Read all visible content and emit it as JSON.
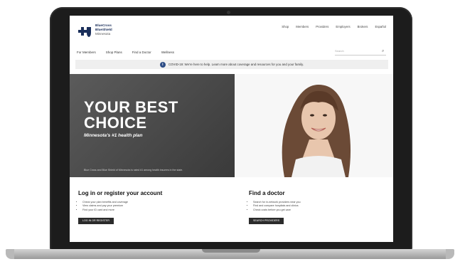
{
  "brand": {
    "line1": "BlueCross",
    "line2": "BlueShield",
    "line3": "Minnesota"
  },
  "utility_nav": [
    "Shop",
    "Members",
    "Providers",
    "Employers",
    "Brokers",
    "Español"
  ],
  "main_nav": [
    "For Members",
    "Shop Plans",
    "Find a Doctor",
    "Wellness"
  ],
  "search": {
    "placeholder": "Search"
  },
  "notice": {
    "text": "COVID-19: We're here to help. Learn more about coverage and resources for you and your family."
  },
  "hero": {
    "title_line1": "YOUR BEST",
    "title_line2": "CHOICE",
    "tagline": "Minnesota's #1 health plan",
    "footnote": "Blue Cross and Blue Shield of Minnesota is rated #1 among health insurers in the state."
  },
  "account": {
    "title": "Log in or register your account",
    "bullets": [
      "Check your plan benefits and coverage",
      "View claims and pay your premium",
      "Find your ID card and more"
    ],
    "button": "LOG IN OR REGISTER"
  },
  "doctor": {
    "title": "Find a doctor",
    "bullets": [
      "Search for in-network providers near you",
      "Find and compare hospitals and clinics",
      "Check costs before you get care"
    ],
    "button": "SEARCH PROVIDERS"
  },
  "colors": {
    "bezel": "#1c1c1c",
    "brand_navy": "#1a2e5a",
    "hero_bg": "#4a4a4a",
    "cta_bg": "#2b2b2b"
  }
}
